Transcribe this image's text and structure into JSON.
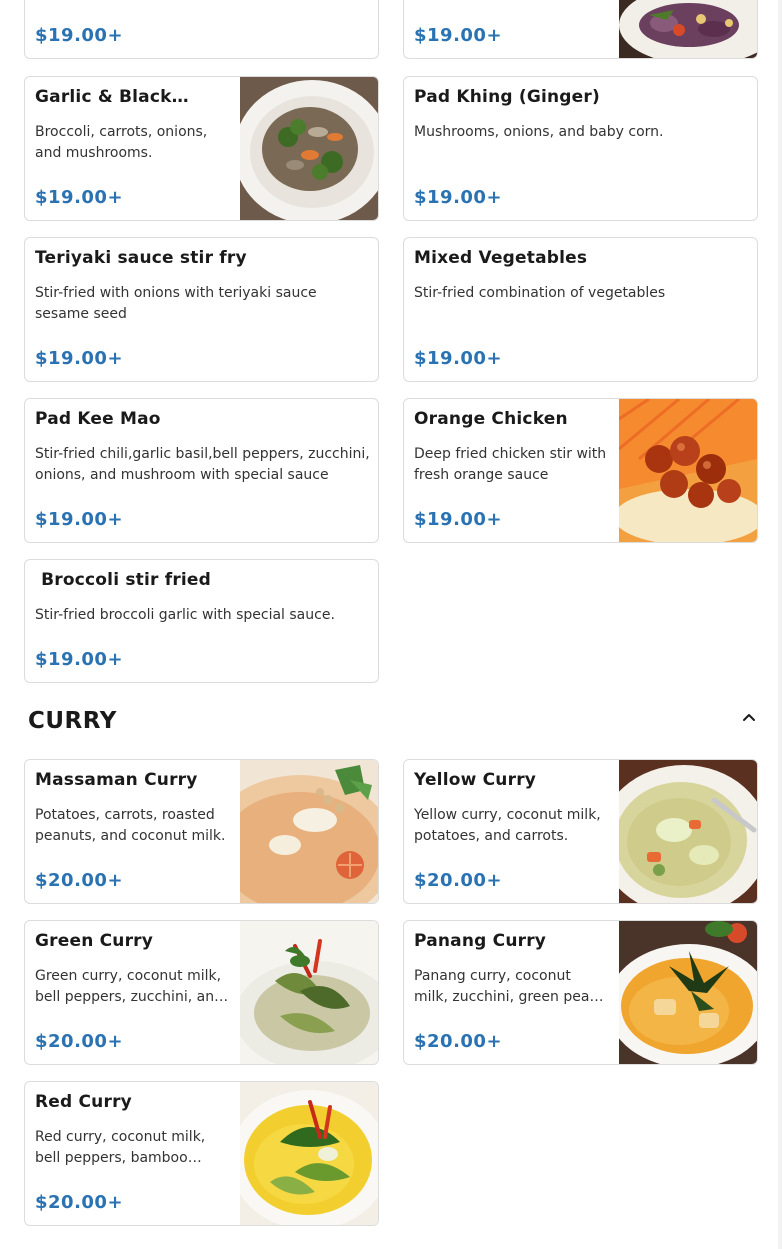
{
  "sections": [
    {
      "title": "",
      "items": [
        {
          "name": "",
          "description": "",
          "price": "$19.00+",
          "image": "dish-photo"
        },
        {
          "name": "",
          "description": "",
          "price": "$19.00+",
          "image": "dish-photo"
        },
        {
          "name": "Garlic & Black…",
          "description": "Broccoli, carrots, onions, and mushrooms.",
          "price": "$19.00+",
          "image": "dish-photo"
        },
        {
          "name": "Pad Khing (Ginger)",
          "description": "Mushrooms, onions, and baby corn.",
          "price": "$19.00+",
          "image": ""
        },
        {
          "name": "Teriyaki sauce stir fry",
          "description": "Stir-fried with onions with teriyaki sauce sesame seed",
          "price": "$19.00+",
          "image": ""
        },
        {
          "name": "Mixed Vegetables",
          "description": "Stir-fried combination of vegetables",
          "price": "$19.00+",
          "image": ""
        },
        {
          "name": "Pad Kee Mao",
          "description": "Stir-fried chili,garlic basil,bell peppers, zucchini, onions, and mushroom with special sauce",
          "price": "$19.00+",
          "image": ""
        },
        {
          "name": "Orange Chicken",
          "description": "Deep fried chicken stir with fresh orange sauce",
          "price": "$19.00+",
          "image": "dish-photo"
        },
        {
          "name": " Broccoli stir fried",
          "description": "Stir-fried broccoli garlic with special sauce.",
          "price": "$19.00+",
          "image": ""
        }
      ]
    },
    {
      "title": "CURRY",
      "collapse_icon": "chevron-up-icon",
      "items": [
        {
          "name": "Massaman Curry",
          "description": "Potatoes, carrots, roasted peanuts, and coconut milk.",
          "price": "$20.00+",
          "image": "dish-photo"
        },
        {
          "name": "Yellow Curry",
          "description": "Yellow curry, coconut milk, potatoes, and carrots.",
          "price": "$20.00+",
          "image": "dish-photo"
        },
        {
          "name": "Green Curry",
          "description": "Green curry, coconut milk, bell peppers, zucchini, and basil.",
          "price": "$20.00+",
          "image": "dish-photo"
        },
        {
          "name": "Panang Curry",
          "description": "Panang curry, coconut milk, zucchini, green peas, and bell peppers.",
          "price": "$20.00+",
          "image": "dish-photo"
        },
        {
          "name": "Red Curry",
          "description": "Red curry, coconut milk, bell peppers, bamboo shoots, and basil.",
          "price": "$20.00+",
          "image": "dish-photo"
        }
      ]
    }
  ],
  "colors": {
    "price": "#2a72b2",
    "border": "#dcdcdc"
  }
}
